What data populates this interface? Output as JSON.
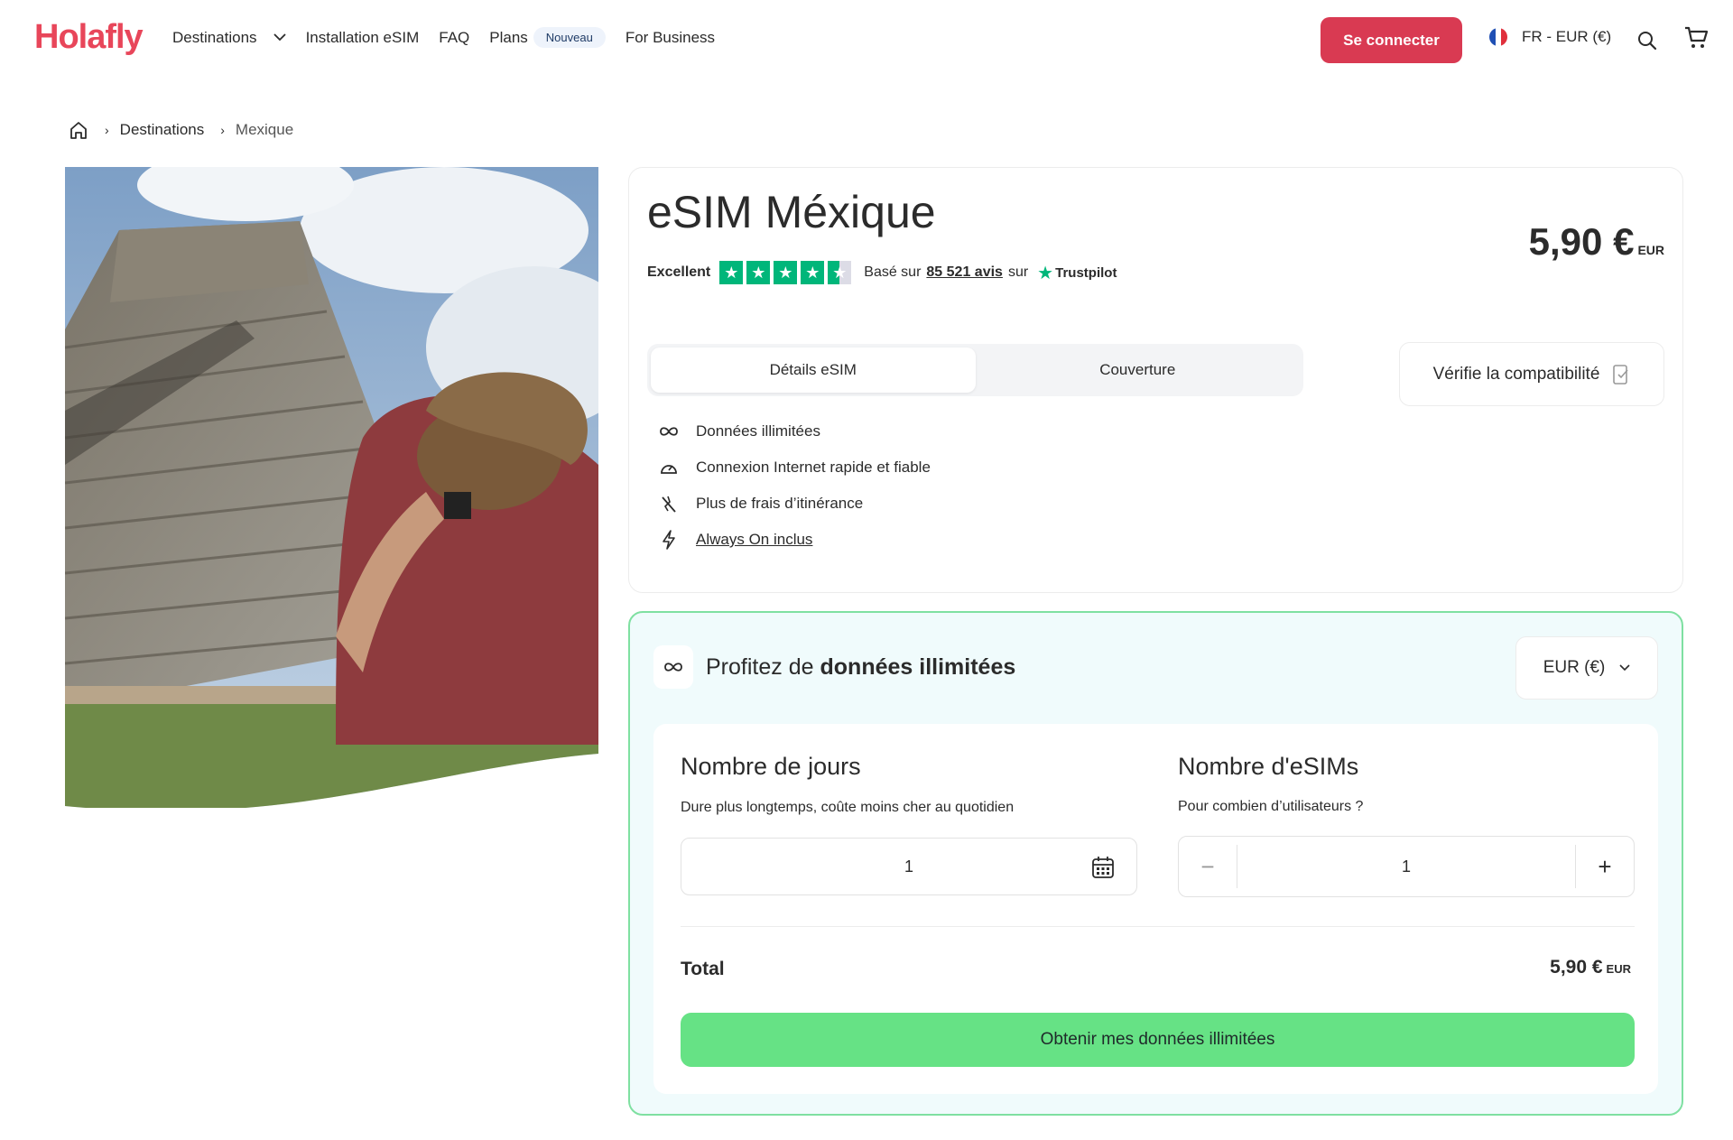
{
  "header": {
    "logo": "Holafly",
    "nav": [
      {
        "label": "Destinations"
      },
      {
        "label": "Installation eSIM"
      },
      {
        "label": "FAQ"
      },
      {
        "label": "Plans",
        "badge": "Nouveau"
      },
      {
        "label": "For Business"
      }
    ],
    "login_label": "Se connecter",
    "locale_label": "FR - EUR (€)",
    "icons": [
      "fr-flag-icon",
      "search-icon",
      "cart-icon",
      "chevron-down-icon"
    ]
  },
  "breadcrumb": {
    "items": [
      "Destinations",
      "Mexique"
    ],
    "icon": "home-icon"
  },
  "product": {
    "title": "eSIM Méxique",
    "price": "5,90 €",
    "price_currency": "EUR",
    "rating": {
      "label": "Excellent",
      "stars": 4.5,
      "based_on": "Basé sur",
      "count": "85 521 avis",
      "on": "sur",
      "provider": "Trustpilot"
    },
    "tabs": [
      "Détails eSIM",
      "Couverture"
    ],
    "compat_label": "Vérifie la compatibilité",
    "features": [
      {
        "icon": "infinity-icon",
        "label": "Données illimitées"
      },
      {
        "icon": "speedometer-icon",
        "label": "Connexion Internet rapide et fiable"
      },
      {
        "icon": "no-roaming-icon",
        "label": "Plus de frais d’itinérance"
      },
      {
        "icon": "lightning-icon",
        "label": "Always On inclus"
      }
    ]
  },
  "plan": {
    "head_prefix": "Profitez de",
    "head_bold": "données illimitées",
    "currency_label": "EUR (€)",
    "days": {
      "title": "Nombre de jours",
      "subtitle": "Dure plus longtemps, coûte moins cher au quotidien",
      "value": "1"
    },
    "esims": {
      "title": "Nombre d'eSIMs",
      "subtitle": "Pour combien d’utilisateurs ?",
      "value": "1",
      "minus": "−",
      "plus": "+"
    },
    "total_label": "Total",
    "total_price": "5,90 €",
    "total_currency": "EUR",
    "cta_label": "Obtenir mes données illimitées"
  },
  "colors": {
    "brand": "#e8465a",
    "login": "#d93a52",
    "cta": "#66e285",
    "trustpilot": "#00b67a",
    "plan_border": "#7fe0a1",
    "plan_bg": "#f0fbfc"
  }
}
